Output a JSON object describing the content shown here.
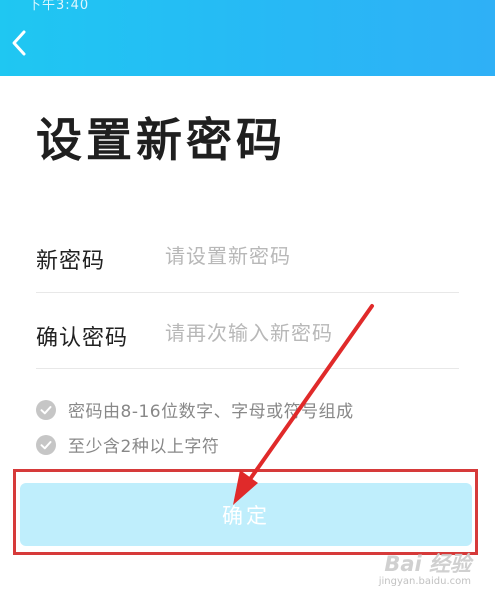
{
  "status_bar": {
    "text": "下午3:40"
  },
  "header": {
    "back_icon": "chevron-left-icon"
  },
  "page": {
    "title": "设置新密码"
  },
  "form": {
    "new_password": {
      "label": "新密码",
      "placeholder": "请设置新密码"
    },
    "confirm_password": {
      "label": "确认密码",
      "placeholder": "请再次输入新密码"
    }
  },
  "rules": [
    {
      "text": "密码由8-16位数字、字母或符号组成",
      "icon": "check-circle-icon"
    },
    {
      "text": "至少含2种以上字符",
      "icon": "check-circle-icon"
    }
  ],
  "actions": {
    "confirm_label": "确定"
  },
  "watermark": {
    "logo": "Bai 经验",
    "url": "jingyan.baidu.com"
  },
  "colors": {
    "header_start": "#1fc7f2",
    "header_end": "#2fb0f6",
    "button_bg": "#bfeefc",
    "annotation": "#d63a3a"
  }
}
